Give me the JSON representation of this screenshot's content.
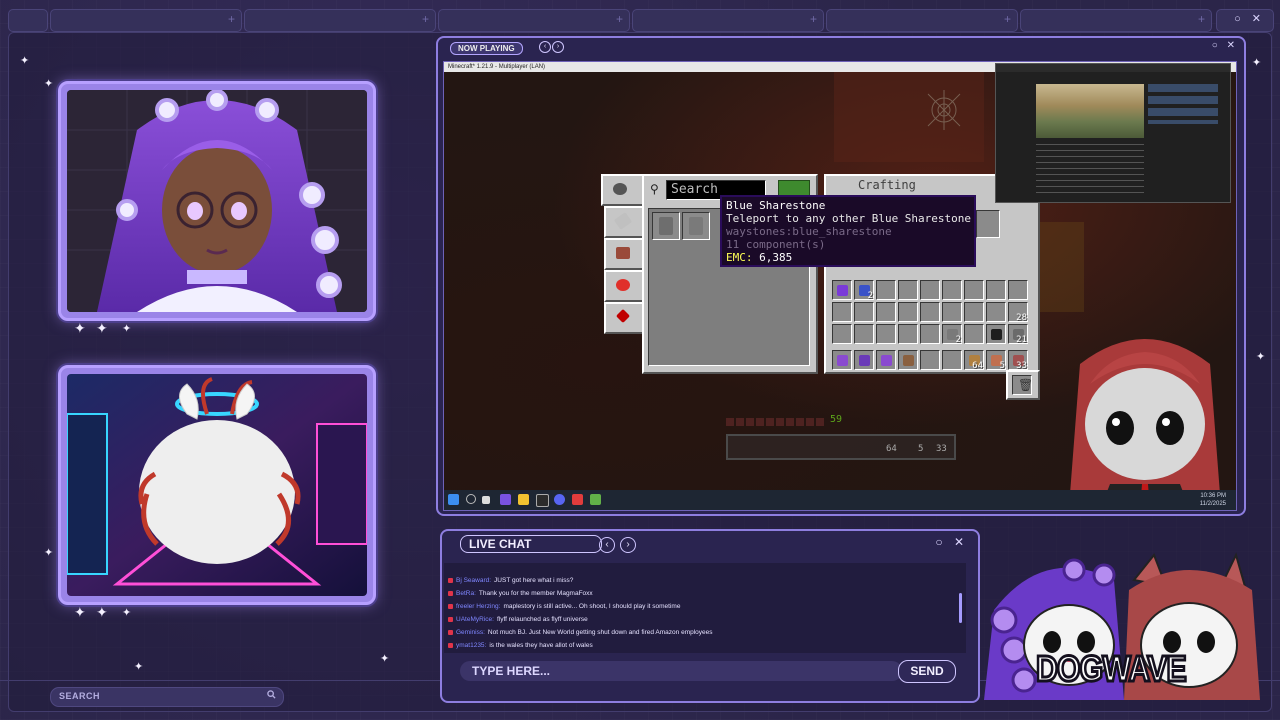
{
  "top": {
    "tabs": [
      {
        "id": "tab-1"
      },
      {
        "id": "tab-2"
      },
      {
        "id": "tab-3"
      },
      {
        "id": "tab-4"
      },
      {
        "id": "tab-5"
      },
      {
        "id": "tab-6"
      }
    ],
    "window_controls": "○ ✕"
  },
  "search": {
    "label": "SEARCH",
    "icon": "search-icon"
  },
  "now_playing": {
    "label": "NOW PLAYING",
    "controls": "○ ✕",
    "prev_icon": "chevron-left-icon",
    "next_icon": "chevron-right-icon"
  },
  "game": {
    "window_title": "Minecraft* 1.21.9 - Multiplayer (LAN)",
    "search_placeholder": "Search",
    "crafting_label": "Crafting",
    "tooltip": {
      "name": "Blue Sharestone",
      "description": "Teleport to any other Blue Sharestone",
      "id": "waystones:blue_sharestone",
      "components": "11 component(s)",
      "emc_label": "EMC:",
      "emc_value": "6,385"
    },
    "stack_counts": [
      "2",
      "28",
      "2",
      "21",
      "64",
      "5",
      "33"
    ],
    "hotbar_level": "59",
    "hotbar_counts": [
      "64",
      "5",
      "33"
    ],
    "taskbar_time": "10:36 PM",
    "taskbar_date": "11/2/2025",
    "colors": {
      "tooltip_name": "#ffffff",
      "tooltip_desc": "#e8e8e8",
      "tooltip_id": "#7a6a88",
      "emc": "#ffff55"
    }
  },
  "chat": {
    "title": "LIVE CHAT",
    "controls": "○ ✕",
    "messages": [
      {
        "user": "Bj Seaward:",
        "text": "JUST got here what i miss?"
      },
      {
        "user": "BetRa:",
        "text": "Thank you for the member MagmaFoxx"
      },
      {
        "user": "freeler Herzing:",
        "text": "maplestory is still active... Oh shoot, I should play it sometime"
      },
      {
        "user": "UAteMyRice:",
        "text": "flyff relaunched as flyff universe"
      },
      {
        "user": "Geminiss:",
        "text": "Not much BJ. Just New World getting shut down and fired Amazon employees"
      },
      {
        "user": "ymat1235:",
        "text": "is the wales they have allot of wales"
      }
    ],
    "input_placeholder": "TYPE HERE...",
    "send_label": "SEND",
    "colors": {
      "accent": "#8e7ee0",
      "user": "#7f86ff",
      "badge": "#e0344a"
    }
  },
  "brand": {
    "name": "DOGWAVE"
  }
}
